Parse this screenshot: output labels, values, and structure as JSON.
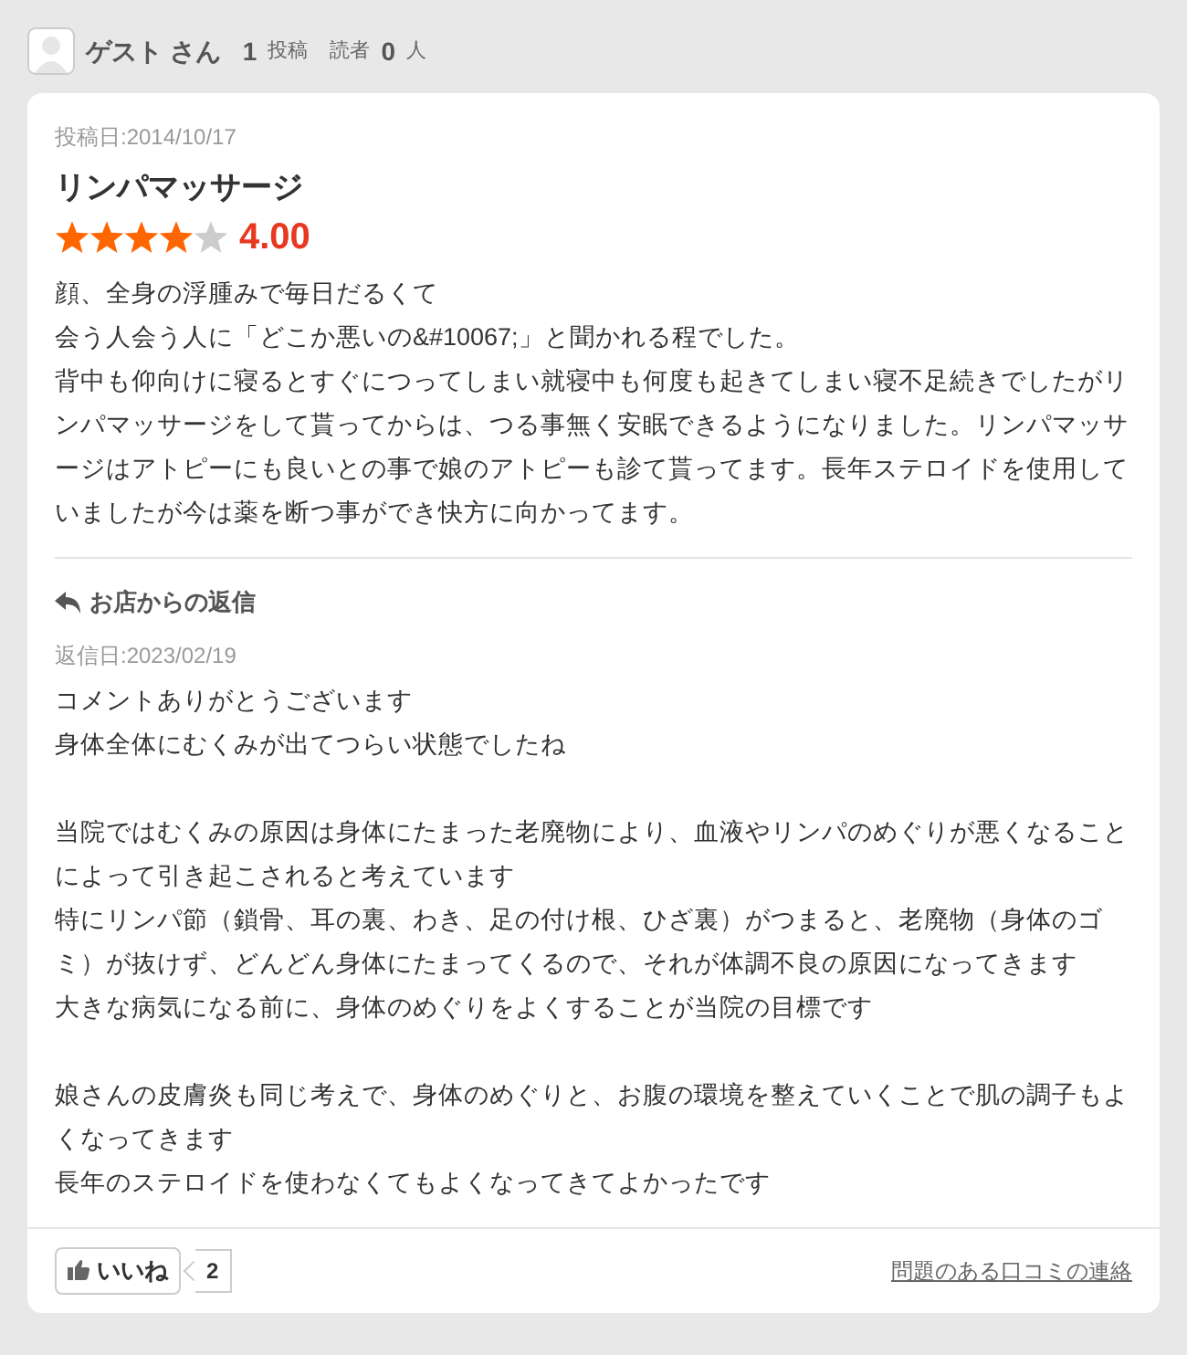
{
  "user": {
    "name": "ゲスト さん",
    "posts_count": "1",
    "posts_label": "投稿",
    "readers_label": "読者",
    "readers_count": "0",
    "readers_unit": "人"
  },
  "review": {
    "date": "投稿日:2014/10/17",
    "title": "リンパマッサージ",
    "stars": 4,
    "score": "4.00",
    "body": [
      "顔、全身の浮腫みで毎日だるくて",
      "会う人会う人に「どこか悪いの&#10067;」と聞かれる程でした。",
      "背中も仰向けに寝るとすぐにつってしまい就寝中も何度も起きてしまい寝不足続きでしたがリンパマッサージをして貰ってからは、つる事無く安眠できるようになりました。リンパマッサージはアトピーにも良いとの事で娘のアトピーも診て貰ってます。長年ステロイドを使用していましたが今は薬を断つ事ができ快方に向かってます。"
    ]
  },
  "reply": {
    "heading": "お店からの返信",
    "date": "返信日:2023/02/19",
    "paragraphs": [
      [
        "コメントありがとうございます",
        "身体全体にむくみが出てつらい状態でしたね"
      ],
      [
        "当院ではむくみの原因は身体にたまった老廃物により、血液やリンパのめぐりが悪くなることによって引き起こされると考えています",
        "特にリンパ節（鎖骨、耳の裏、わき、足の付け根、ひざ裏）がつまると、老廃物（身体のゴミ）が抜けず、どんどん身体にたまってくるので、それが体調不良の原因になってきます",
        "大きな病気になる前に、身体のめぐりをよくすることが当院の目標です"
      ],
      [
        "娘さんの皮膚炎も同じ考えで、身体のめぐりと、お腹の環境を整えていくことで肌の調子もよくなってきます",
        "長年のステロイドを使わなくてもよくなってきてよかったです"
      ]
    ]
  },
  "footer": {
    "like_label": "いいね",
    "like_count": "2",
    "report_link": "問題のある口コミの連絡"
  }
}
